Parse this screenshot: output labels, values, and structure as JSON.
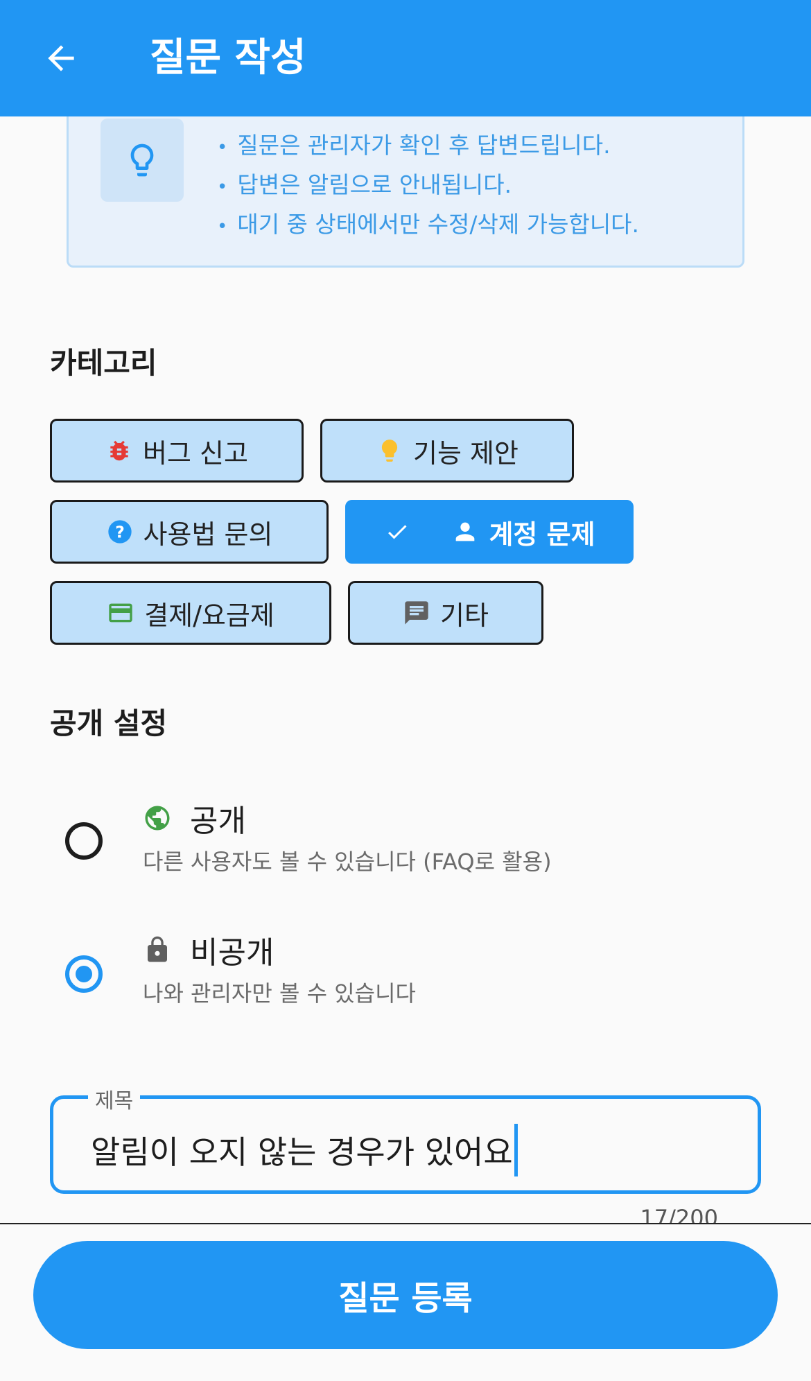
{
  "appbar": {
    "title": "질문 작성",
    "back_icon": "arrow-back-icon"
  },
  "info": {
    "icon": "lightbulb-icon",
    "lines": [
      "질문은 관리자가 확인 후 답변드립니다.",
      "답변은 알림으로 안내됩니다.",
      "대기 중 상태에서만 수정/삭제 가능합니다."
    ]
  },
  "category": {
    "label": "카테고리",
    "chips": [
      {
        "label": "버그 신고",
        "icon": "bug-icon",
        "color": "#e53935",
        "selected": false
      },
      {
        "label": "기능 제안",
        "icon": "lightbulb-icon",
        "color": "#fbc02d",
        "selected": false
      },
      {
        "label": "사용법 문의",
        "icon": "help-icon",
        "color": "#2196f3",
        "selected": false
      },
      {
        "label": "계정 문제",
        "icon": "person-icon",
        "color": "#ffffff",
        "selected": true
      },
      {
        "label": "결제/요금제",
        "icon": "credit-card-icon",
        "color": "#43a047",
        "selected": false
      },
      {
        "label": "기타",
        "icon": "chat-icon",
        "color": "#616161",
        "selected": false
      }
    ]
  },
  "visibility": {
    "label": "공개 설정",
    "options": [
      {
        "title": "공개",
        "subtitle": "다른 사용자도 볼 수 있습니다 (FAQ로 활용)",
        "icon": "globe-icon",
        "selected": false
      },
      {
        "title": "비공개",
        "subtitle": "나와 관리자만 볼 수 있습니다",
        "icon": "lock-icon",
        "selected": true
      }
    ]
  },
  "title_field": {
    "label": "제목",
    "value": "알림이 오지 않는 경우가 있어요",
    "counter": "17/200"
  },
  "submit": {
    "label": "질문 등록"
  },
  "colors": {
    "primary": "#2196f3",
    "chip_bg": "#bfe0fa",
    "info_text": "#3b9ae6"
  }
}
